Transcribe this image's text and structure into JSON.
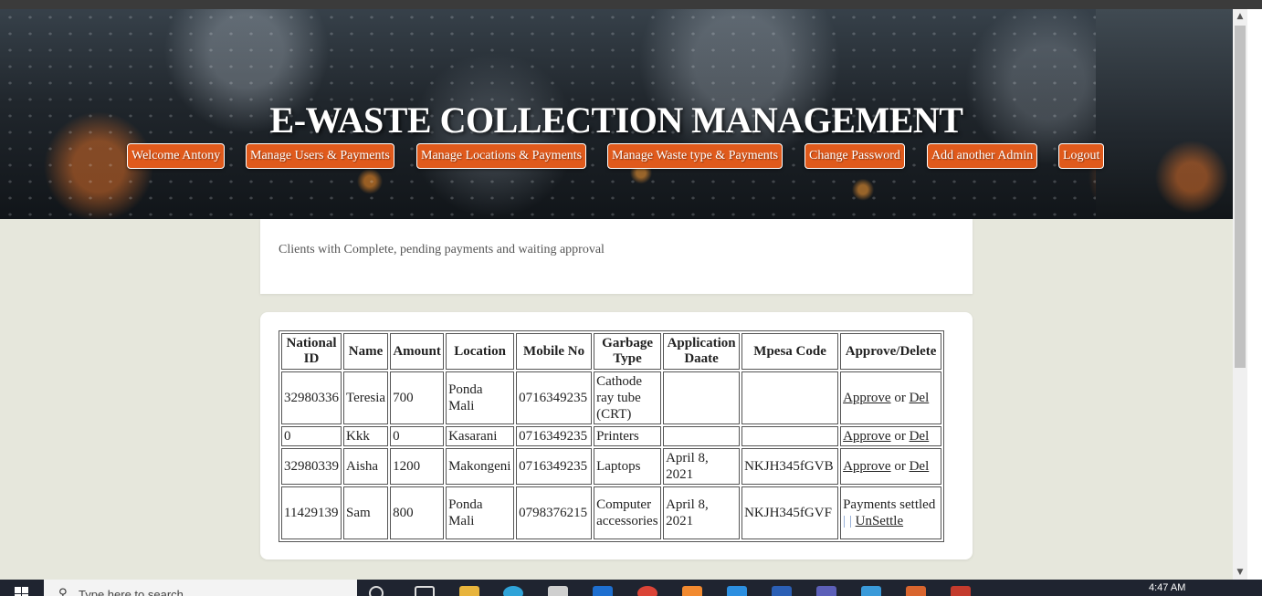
{
  "header": {
    "title": "E-WASTE COLLECTION MANAGEMENT",
    "nav": [
      {
        "label": "Welcome Antony"
      },
      {
        "label": "Manage Users & Payments"
      },
      {
        "label": "Manage Locations & Payments"
      },
      {
        "label": "Manage Waste type & Payments"
      },
      {
        "label": "Change Password"
      },
      {
        "label": "Add another Admin"
      },
      {
        "label": "Logout"
      }
    ]
  },
  "info": {
    "text": "Clients with Complete, pending payments and waiting approval"
  },
  "table": {
    "columns": [
      "National ID",
      "Name",
      "Amount",
      "Location",
      "Mobile No",
      "Garbage Type",
      "Application Daate",
      "Mpesa Code",
      "Approve/Delete"
    ],
    "rows": [
      {
        "national_id": "32980336",
        "name": "Teresia",
        "amount": "700",
        "location": "Ponda Mali",
        "mobile": "0716349235",
        "garbage_type": "Cathode ray tube (CRT)",
        "app_date": "",
        "mpesa": "",
        "approve": "Approve",
        "or": "or",
        "del": "Del"
      },
      {
        "national_id": "0",
        "name": "Kkk",
        "amount": "0",
        "location": "Kasarani",
        "mobile": "0716349235",
        "garbage_type": "Printers",
        "app_date": "",
        "mpesa": "",
        "approve": "Approve",
        "or": "or",
        "del": "Del"
      },
      {
        "national_id": "32980339",
        "name": "Aisha",
        "amount": "1200",
        "location": "Makongeni",
        "mobile": "0716349235",
        "garbage_type": "Laptops",
        "app_date": "April 8, 2021",
        "mpesa": "NKJH345fGVB",
        "approve": "Approve",
        "or": "or",
        "del": "Del"
      },
      {
        "national_id": "11429139",
        "name": "Sam",
        "amount": "800",
        "location": "Ponda Mali",
        "mobile": "0798376215",
        "garbage_type": "Computer accessories",
        "app_date": "April 8, 2021",
        "mpesa": "NKJH345fGVF",
        "settled": "Payments settled",
        "sep": "| |",
        "unsettle": "UnSettle"
      }
    ]
  },
  "taskbar": {
    "search_placeholder": "Type here to search",
    "clock": "4:47 AM"
  },
  "colors": {
    "nav_button": "#e05a1c",
    "page_background": "#e6e7dc",
    "taskbar": "#1f2430"
  }
}
